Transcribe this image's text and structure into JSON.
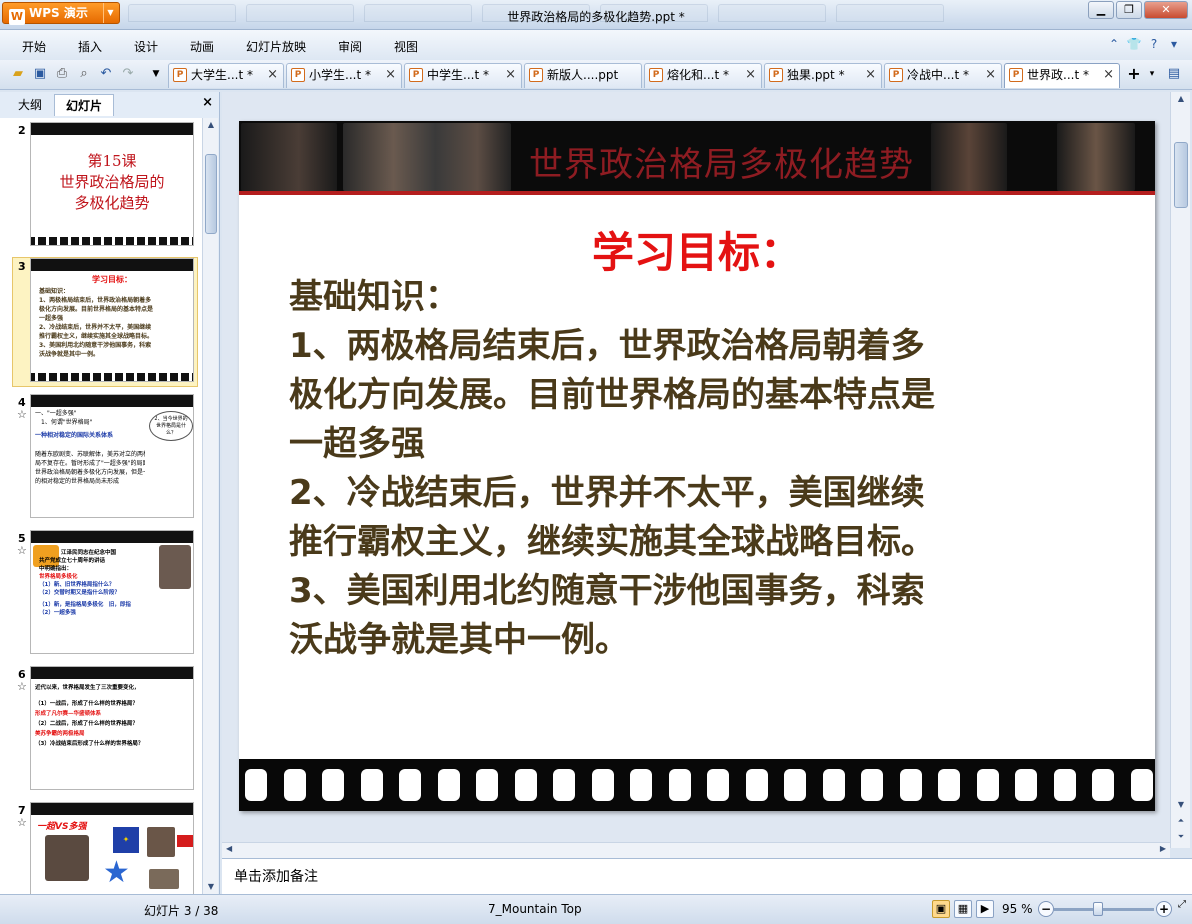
{
  "app": {
    "button_label": "WPS 演示",
    "logo_letter": "W",
    "window_title": "世界政治格局的多极化趋势.ppt *"
  },
  "menu": [
    "开始",
    "插入",
    "设计",
    "动画",
    "幻灯片放映",
    "审阅",
    "视图"
  ],
  "doc_tabs": [
    "大学生...t *",
    "小学生...t *",
    "中学生...t *",
    "新版人....ppt",
    "熔化和...t *",
    "独果.ppt *",
    "冷战中...t *",
    "世界政...t *"
  ],
  "active_tab_index": 7,
  "panel": {
    "tabs": [
      "大纲",
      "幻灯片"
    ],
    "active": "幻灯片"
  },
  "thumbnails": [
    {
      "num": "2",
      "title_lines": [
        "第15课",
        "世界政治格局的",
        "多极化趋势"
      ]
    },
    {
      "num": "3",
      "title": "学习目标：",
      "lines": [
        "基础知识：",
        "1、两极格局结束后，世界政治格局朝着多",
        "极化方向发展。目前世界格局的基本特点是",
        "一超多强",
        "2、冷战结束后，世界并不太平，美国继续",
        "推行霸权主义，继续实施其全球战略目标。",
        "3、美国利用北约随意干涉他国事务，科索",
        "沃战争就是其中一例。"
      ]
    },
    {
      "num": "4",
      "lines": [
        "一、\"一超多强\"",
        "1、何谓\"世界格局\"",
        "一种相对稳定的国际关系体系",
        "随着东欧剧变、苏联解体，美苏对立的两极格",
        "局不复存在。暂时形成了\"一超多强\"的局面，",
        "世界政治格局朝着多极化方向发展，但是一个新",
        "的相对稳定的世界格局尚未形成"
      ],
      "bubble": "2、当今世界的世界格局是什么？"
    },
    {
      "num": "5",
      "lines": [
        "江泽民同志在纪念中国",
        "共产党成立七十周年的讲话",
        "中明确指出：",
        "世界格局多极化",
        "（1）新、旧世界格局指什么？",
        "（2）交替时期又是指什么阶段？",
        "（1）新，是指格局多极化　旧，即指",
        "（2）一超多强"
      ]
    },
    {
      "num": "6",
      "lines": [
        "近代以来，世界格局发生了三次重要变化，",
        "（1）一战后，形成了什么样的世界格局？",
        "形成了凡尔赛—华盛顿体系",
        "（2）二战后，形成了什么样的世界格局？",
        "美苏争霸的两极格局",
        "（3）冷战结束后形成了什么样的世界格局？"
      ]
    },
    {
      "num": "7",
      "title": "一超VS多强"
    }
  ],
  "slide": {
    "banner_title": "世界政治格局多极化趋势",
    "heading": "学习目标：",
    "body": [
      "基础知识：",
      "1、两极格局结束后，世界政治格局朝着多",
      "极化方向发展。目前世界格局的基本特点是",
      "一超多强",
      "2、冷战结束后，世界并不太平，美国继续",
      "推行霸权主义，继续实施其全球战略目标。",
      "3、美国利用北约随意干涉他国事务，科索",
      "沃战争就是其中一例。"
    ]
  },
  "notes_placeholder": "单击添加备注",
  "status": {
    "slide_counter": "幻灯片 3 / 38",
    "theme": "7_Mountain Top",
    "zoom": "95 %"
  },
  "colors": {
    "heading": "#e41212",
    "body": "#4a3a1a",
    "banner": "#8e1c22"
  }
}
